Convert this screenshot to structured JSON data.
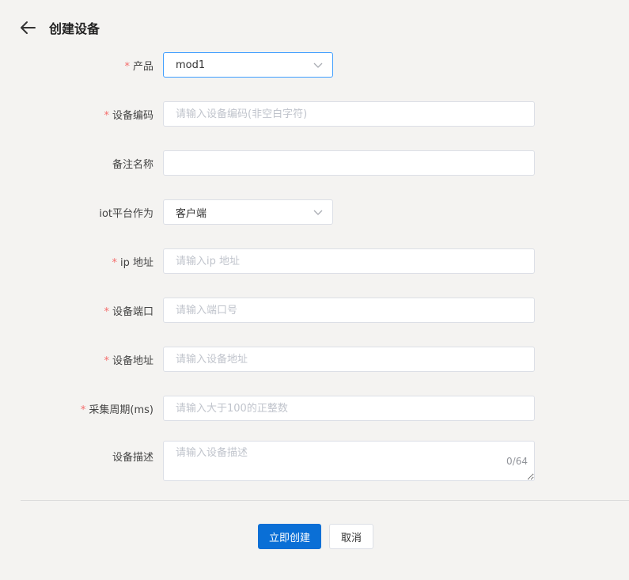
{
  "header": {
    "title": "创建设备",
    "back_icon": "arrow-left-icon"
  },
  "form": {
    "product": {
      "required": "*",
      "label": "产品",
      "value": "mod1"
    },
    "device_code": {
      "required": "*",
      "label": "设备编码",
      "placeholder": "请输入设备编码(非空白字符)",
      "value": ""
    },
    "remark_name": {
      "label": "备注名称",
      "placeholder": "",
      "value": ""
    },
    "iot_role": {
      "label": "iot平台作为",
      "value": "客户端"
    },
    "ip_address": {
      "required": "*",
      "label": "ip 地址",
      "placeholder": "请输入ip 地址",
      "value": ""
    },
    "device_port": {
      "required": "*",
      "label": "设备端口",
      "placeholder": "请输入端口号",
      "value": ""
    },
    "device_address": {
      "required": "*",
      "label": "设备地址",
      "placeholder": "请输入设备地址",
      "value": ""
    },
    "collect_period": {
      "required": "*",
      "label": "采集周期(ms)",
      "placeholder": "请输入大于100的正整数",
      "value": ""
    },
    "description": {
      "label": "设备描述",
      "placeholder": "请输入设备描述",
      "value": "",
      "counter": "0/64"
    }
  },
  "actions": {
    "submit_label": "立即创建",
    "cancel_label": "取消"
  },
  "colors": {
    "primary": "#0a6fd6",
    "required": "#f56c6c",
    "focus_border": "#409eff",
    "background": "#f4f3f1"
  }
}
